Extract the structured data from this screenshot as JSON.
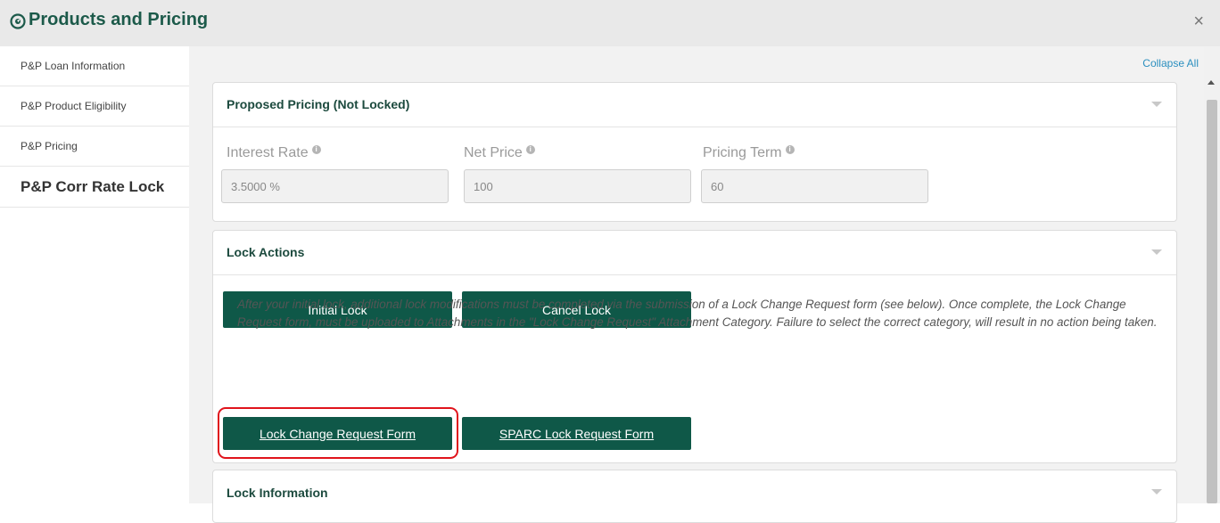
{
  "header": {
    "title": "Products and Pricing",
    "icon": "compass-icon",
    "close_label": "×"
  },
  "sidebar": {
    "items": [
      {
        "label": "P&P Loan Information"
      },
      {
        "label": "P&P Product Eligibility"
      },
      {
        "label": "P&P Pricing"
      },
      {
        "label": "P&P Corr Rate Lock",
        "active": true
      }
    ]
  },
  "main": {
    "collapse_all": "Collapse All",
    "proposed_pricing": {
      "title": "Proposed Pricing (Not Locked)",
      "fields": [
        {
          "label": "Interest Rate",
          "value": "3.5000 %"
        },
        {
          "label": "Net Price",
          "value": "100"
        },
        {
          "label": "Pricing Term",
          "value": "60"
        }
      ]
    },
    "lock_actions": {
      "title": "Lock Actions",
      "initial_lock": "Initial Lock",
      "cancel_lock": "Cancel Lock",
      "note": "After your initial lock, additional lock modifications must be completed via the submission of a Lock Change Request form (see below). Once complete, the Lock Change Request form, must be uploaded to Attachments in the \"Lock Change Request\" Attachment Category. Failure to select the correct category, will result in no action being taken.",
      "lock_change_form": "Lock Change Request Form",
      "sparc_form": "SPARC Lock Request Form"
    },
    "lock_information": {
      "title": "Lock Information"
    }
  },
  "colors": {
    "brand_green": "#0f5848",
    "title_green": "#1c5a4a",
    "highlight_red": "#e0141c",
    "link_blue": "#2b8fbf"
  }
}
